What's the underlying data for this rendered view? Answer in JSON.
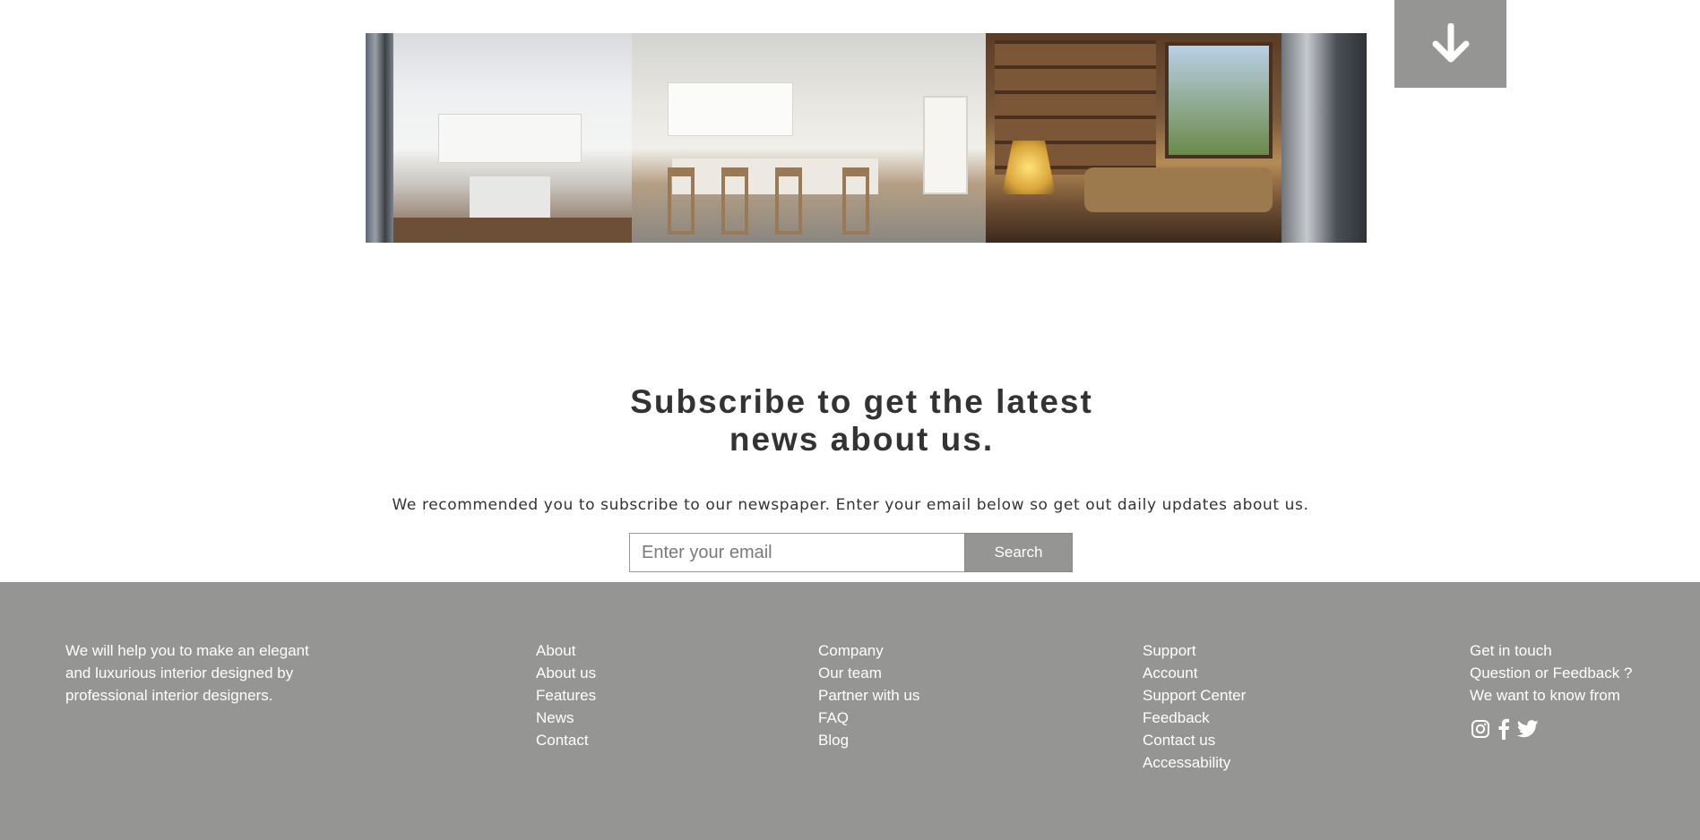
{
  "scroll_button": {
    "icon": "arrow-down-icon"
  },
  "gallery": {
    "images": [
      {
        "name": "gallery-image-wall-art"
      },
      {
        "name": "gallery-image-white-kitchen"
      },
      {
        "name": "gallery-image-kitchen-island"
      },
      {
        "name": "gallery-image-living-room"
      },
      {
        "name": "gallery-image-modern-kitchen"
      }
    ]
  },
  "subscribe": {
    "title_line1": "Subscribe to get the latest",
    "title_line2": "news about us.",
    "description": "We recommended you to subscribe to our newspaper. Enter your email below so get out daily updates about us.",
    "email_placeholder": "Enter your email",
    "button_label": "Search"
  },
  "footer": {
    "about": "We will help you to make an elegant and luxurious interior designed by professional interior designers.",
    "col1": [
      "About",
      "About us",
      "Features",
      "News",
      "Contact"
    ],
    "col2": [
      "Company",
      "Our team",
      "Partner with us",
      "FAQ",
      "Blog"
    ],
    "col3": [
      "Support",
      "Account",
      "Support Center",
      "Feedback",
      "Contact us",
      "Accessability"
    ],
    "col4": [
      "Get in touch",
      "Question or Feedback ?",
      "We want to know from"
    ],
    "socials": [
      "instagram-icon",
      "facebook-icon",
      "twitter-icon"
    ]
  },
  "colors": {
    "gray": "#959594",
    "text": "#333333",
    "white": "#ffffff"
  }
}
